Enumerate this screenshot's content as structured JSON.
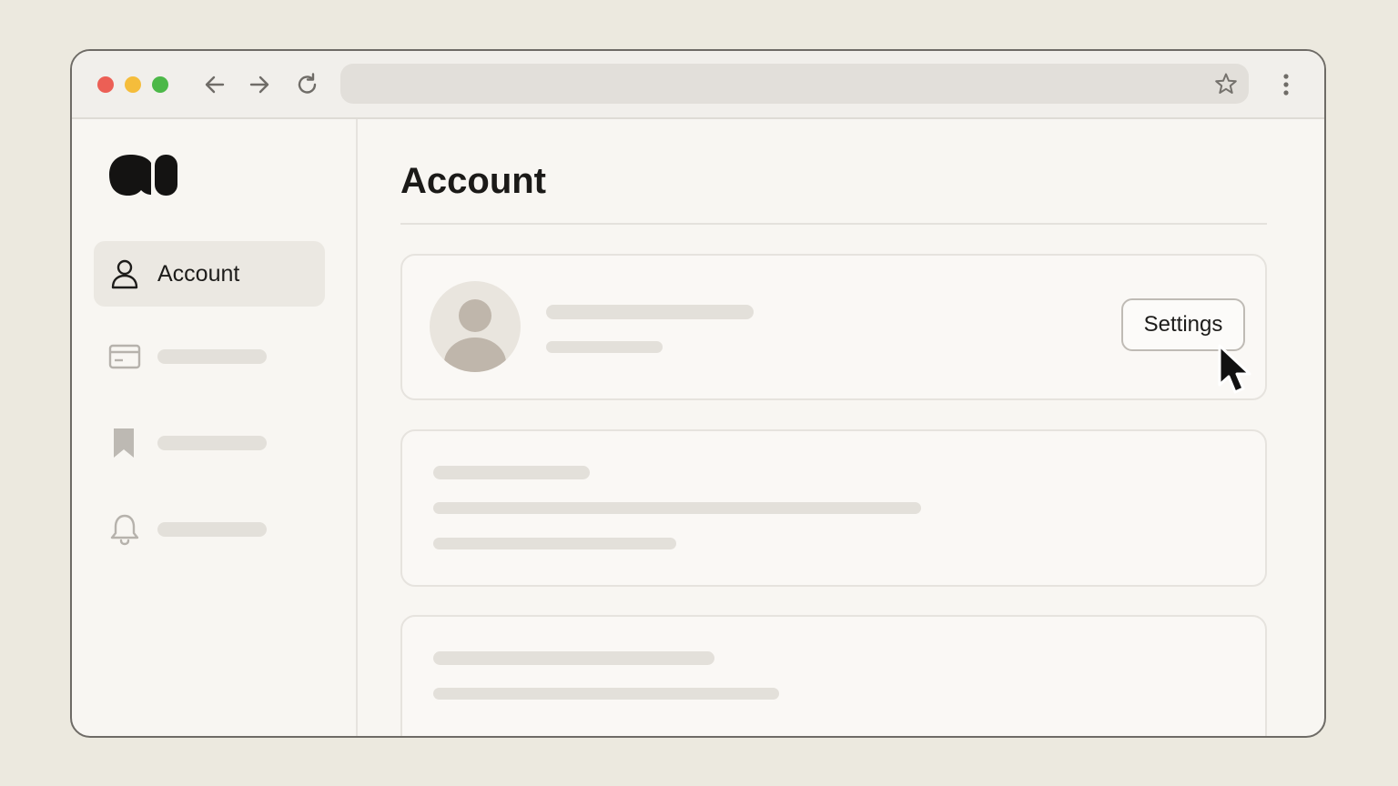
{
  "browser": {
    "controls": {
      "close_color": "#ec5f55",
      "minimize_color": "#f5bd3b",
      "maximize_color": "#4cb848"
    },
    "icons": [
      "back-arrow-icon",
      "forward-arrow-icon",
      "reload-icon",
      "star-icon",
      "more-vertical-icon"
    ]
  },
  "sidebar": {
    "logo": "brand-logo",
    "items": [
      {
        "label": "Account",
        "icon": "user-icon",
        "active": true
      },
      {
        "label": "",
        "icon": "credit-card-icon",
        "active": false
      },
      {
        "label": "",
        "icon": "bookmark-icon",
        "active": false
      },
      {
        "label": "",
        "icon": "bell-icon",
        "active": false
      }
    ]
  },
  "main": {
    "title": "Account",
    "profile_card": {
      "avatar": "user-avatar-icon",
      "settings_label": "Settings"
    }
  },
  "cursor": "pointer-cursor-icon"
}
